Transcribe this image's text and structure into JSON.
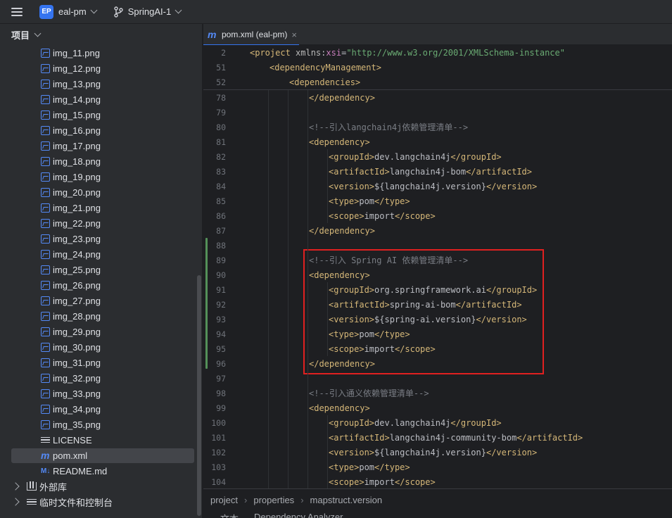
{
  "titlebar": {
    "project_badge": "EP",
    "project_name": "eal-pm",
    "branch_name": "SpringAI-1",
    "icons": [
      "hamburger-menu-icon",
      "chevron-down-icon",
      "git-branch-icon"
    ]
  },
  "sidebar": {
    "header": "项目",
    "files": [
      {
        "name": "img_11.png",
        "icon": "image-icon"
      },
      {
        "name": "img_12.png",
        "icon": "image-icon"
      },
      {
        "name": "img_13.png",
        "icon": "image-icon"
      },
      {
        "name": "img_14.png",
        "icon": "image-icon"
      },
      {
        "name": "img_15.png",
        "icon": "image-icon"
      },
      {
        "name": "img_16.png",
        "icon": "image-icon"
      },
      {
        "name": "img_17.png",
        "icon": "image-icon"
      },
      {
        "name": "img_18.png",
        "icon": "image-icon"
      },
      {
        "name": "img_19.png",
        "icon": "image-icon"
      },
      {
        "name": "img_20.png",
        "icon": "image-icon"
      },
      {
        "name": "img_21.png",
        "icon": "image-icon"
      },
      {
        "name": "img_22.png",
        "icon": "image-icon"
      },
      {
        "name": "img_23.png",
        "icon": "image-icon"
      },
      {
        "name": "img_24.png",
        "icon": "image-icon"
      },
      {
        "name": "img_25.png",
        "icon": "image-icon"
      },
      {
        "name": "img_26.png",
        "icon": "image-icon"
      },
      {
        "name": "img_27.png",
        "icon": "image-icon"
      },
      {
        "name": "img_28.png",
        "icon": "image-icon"
      },
      {
        "name": "img_29.png",
        "icon": "image-icon"
      },
      {
        "name": "img_30.png",
        "icon": "image-icon"
      },
      {
        "name": "img_31.png",
        "icon": "image-icon"
      },
      {
        "name": "img_32.png",
        "icon": "image-icon"
      },
      {
        "name": "img_33.png",
        "icon": "image-icon"
      },
      {
        "name": "img_34.png",
        "icon": "image-icon"
      },
      {
        "name": "img_35.png",
        "icon": "image-icon"
      },
      {
        "name": "LICENSE",
        "icon": "text-file-icon"
      },
      {
        "name": "pom.xml",
        "icon": "maven-icon",
        "selected": true
      },
      {
        "name": "README.md",
        "icon": "markdown-icon",
        "badge": "M↓"
      }
    ],
    "folders": [
      {
        "name": "外部库",
        "icon": "library-icon"
      },
      {
        "name": "临时文件和控制台",
        "icon": "scratch-icon"
      }
    ]
  },
  "editor": {
    "tab": {
      "label": "pom.xml (eal-pm)",
      "icon": "maven-icon",
      "close": "×"
    },
    "sticky_lines": [
      {
        "num": "2",
        "indent": 0,
        "parts": [
          [
            "tag",
            "<project "
          ],
          [
            "attr",
            "xmlns"
          ],
          [
            "txt",
            ":"
          ],
          [
            "ns",
            "xsi"
          ],
          [
            "txt",
            "="
          ],
          [
            "str",
            "\"http://www.w3.org/2001/XMLSchema-instance\""
          ]
        ]
      },
      {
        "num": "51",
        "indent": 1,
        "parts": [
          [
            "tag",
            "<dependencyManagement>"
          ]
        ]
      },
      {
        "num": "52",
        "indent": 2,
        "parts": [
          [
            "tag",
            "<dependencies>"
          ]
        ]
      }
    ],
    "lines": [
      {
        "num": "78",
        "indent": 3,
        "parts": [
          [
            "tag",
            "</dependency>"
          ]
        ]
      },
      {
        "num": "79",
        "indent": 0,
        "parts": []
      },
      {
        "num": "80",
        "indent": 3,
        "parts": [
          [
            "cmt",
            "<!--引入langchain4j依赖管理清单-->"
          ]
        ]
      },
      {
        "num": "81",
        "indent": 3,
        "parts": [
          [
            "tag",
            "<dependency>"
          ]
        ]
      },
      {
        "num": "82",
        "indent": 4,
        "parts": [
          [
            "tag",
            "<groupId>"
          ],
          [
            "txt",
            "dev.langchain4j"
          ],
          [
            "tag",
            "</groupId>"
          ]
        ]
      },
      {
        "num": "83",
        "indent": 4,
        "parts": [
          [
            "tag",
            "<artifactId>"
          ],
          [
            "txt",
            "langchain4j-bom"
          ],
          [
            "tag",
            "</artifactId>"
          ]
        ]
      },
      {
        "num": "84",
        "indent": 4,
        "parts": [
          [
            "tag",
            "<version>"
          ],
          [
            "txt",
            "${langchain4j.version}"
          ],
          [
            "tag",
            "</version>"
          ]
        ]
      },
      {
        "num": "85",
        "indent": 4,
        "parts": [
          [
            "tag",
            "<type>"
          ],
          [
            "txt",
            "pom"
          ],
          [
            "tag",
            "</type>"
          ]
        ]
      },
      {
        "num": "86",
        "indent": 4,
        "parts": [
          [
            "tag",
            "<scope>"
          ],
          [
            "txt",
            "import"
          ],
          [
            "tag",
            "</scope>"
          ]
        ]
      },
      {
        "num": "87",
        "indent": 3,
        "parts": [
          [
            "tag",
            "</dependency>"
          ]
        ]
      },
      {
        "num": "88",
        "indent": 0,
        "parts": []
      },
      {
        "num": "89",
        "indent": 3,
        "parts": [
          [
            "cmt",
            "<!--引入 Spring AI 依赖管理清单-->"
          ]
        ]
      },
      {
        "num": "90",
        "indent": 3,
        "parts": [
          [
            "tag",
            "<dependency>"
          ]
        ]
      },
      {
        "num": "91",
        "indent": 4,
        "parts": [
          [
            "tag",
            "<groupId>"
          ],
          [
            "txt",
            "org.springframework.ai"
          ],
          [
            "tag",
            "</groupId>"
          ]
        ]
      },
      {
        "num": "92",
        "indent": 4,
        "parts": [
          [
            "tag",
            "<artifactId>"
          ],
          [
            "txt",
            "spring-ai-bom"
          ],
          [
            "tag",
            "</artifactId>"
          ]
        ]
      },
      {
        "num": "93",
        "indent": 4,
        "parts": [
          [
            "tag",
            "<version>"
          ],
          [
            "txt",
            "${spring-ai.version}"
          ],
          [
            "tag",
            "</version>"
          ]
        ]
      },
      {
        "num": "94",
        "indent": 4,
        "parts": [
          [
            "tag",
            "<type>"
          ],
          [
            "txt",
            "pom"
          ],
          [
            "tag",
            "</type>"
          ]
        ]
      },
      {
        "num": "95",
        "indent": 4,
        "parts": [
          [
            "tag",
            "<scope>"
          ],
          [
            "txt",
            "import"
          ],
          [
            "tag",
            "</scope>"
          ]
        ]
      },
      {
        "num": "96",
        "indent": 3,
        "parts": [
          [
            "tag",
            "</dependency>"
          ]
        ]
      },
      {
        "num": "97",
        "indent": 0,
        "parts": []
      },
      {
        "num": "98",
        "indent": 3,
        "parts": [
          [
            "cmt",
            "<!--引入通义依赖管理清单-->"
          ]
        ]
      },
      {
        "num": "99",
        "indent": 3,
        "parts": [
          [
            "tag",
            "<dependency>"
          ]
        ]
      },
      {
        "num": "100",
        "indent": 4,
        "parts": [
          [
            "tag",
            "<groupId>"
          ],
          [
            "txt",
            "dev.langchain4j"
          ],
          [
            "tag",
            "</groupId>"
          ]
        ]
      },
      {
        "num": "101",
        "indent": 4,
        "parts": [
          [
            "tag",
            "<artifactId>"
          ],
          [
            "txt",
            "langchain4j-community-bom"
          ],
          [
            "tag",
            "</artifactId>"
          ]
        ]
      },
      {
        "num": "102",
        "indent": 4,
        "parts": [
          [
            "tag",
            "<version>"
          ],
          [
            "txt",
            "${langchain4j.version}"
          ],
          [
            "tag",
            "</version>"
          ]
        ]
      },
      {
        "num": "103",
        "indent": 4,
        "parts": [
          [
            "tag",
            "<type>"
          ],
          [
            "txt",
            "pom"
          ],
          [
            "tag",
            "</type>"
          ]
        ]
      },
      {
        "num": "104",
        "indent": 4,
        "parts": [
          [
            "tag",
            "<scope>"
          ],
          [
            "txt",
            "import"
          ],
          [
            "tag",
            "</scope>"
          ]
        ]
      }
    ],
    "colors": {
      "tag": "#d5b778",
      "attr": "#bababa",
      "ns": "#c77dbb",
      "str": "#6aab73",
      "txt": "#bcbec4",
      "cmt": "#7a7e85",
      "highlight": "#e02020",
      "accent": "#3574f0"
    }
  },
  "breadcrumb": [
    "project",
    "properties",
    "mapstruct.version"
  ],
  "bottom_tabs": [
    "文本",
    "Dependency Analyzer"
  ]
}
